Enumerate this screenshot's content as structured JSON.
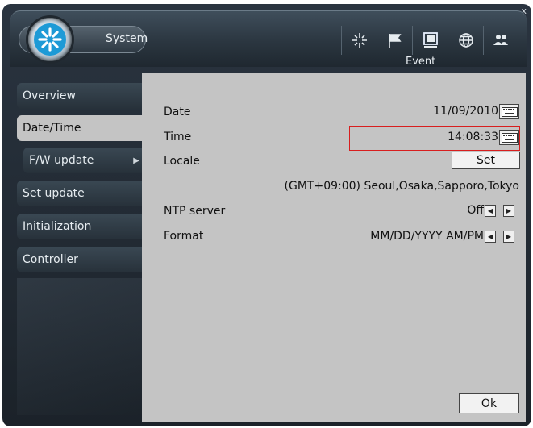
{
  "window": {
    "title": "System",
    "close_label": "x"
  },
  "toolbar": {
    "icons": [
      "network-icon",
      "flag-icon",
      "monitor-icon",
      "globe-icon",
      "users-icon"
    ],
    "active_icon": "monitor-icon"
  },
  "section": "Event",
  "sidebar": {
    "items": [
      {
        "label": "Overview"
      },
      {
        "label": "Date/Time",
        "active": true
      },
      {
        "label": "F/W update",
        "sub": true
      },
      {
        "label": "Set update"
      },
      {
        "label": "Initialization"
      },
      {
        "label": "Controller"
      }
    ]
  },
  "panel": {
    "date": {
      "label": "Date",
      "value": "11/09/2010"
    },
    "time": {
      "label": "Time",
      "value": "14:08:33"
    },
    "locale": {
      "label": "Locale",
      "button": "Set",
      "timezone": "(GMT+09:00) Seoul,Osaka,Sapporo,Tokyo"
    },
    "ntp": {
      "label": "NTP server",
      "value": "Off"
    },
    "format": {
      "label": "Format",
      "value": "MM/DD/YYYY AM/PM"
    },
    "ok_button": "Ok"
  },
  "colors": {
    "highlight": "#d81e1e",
    "panel": "#c4c4c4",
    "chrome": "#27313a"
  }
}
